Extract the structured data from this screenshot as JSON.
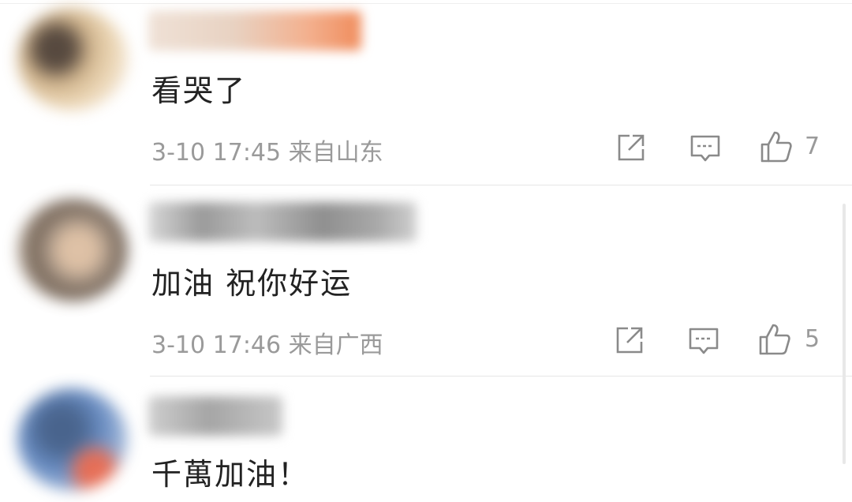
{
  "comments": [
    {
      "text": "看哭了",
      "date": "3-10",
      "time": "17:45",
      "location": "来自山东",
      "likes": "7",
      "avatar_colors": [
        "#c9a87a",
        "#3a2a1e",
        "#e8cfa8"
      ],
      "name_colors": [
        "#e9d8cc",
        "#f0a17a"
      ]
    },
    {
      "text": "加油 祝你好运",
      "date": "3-10",
      "time": "17:46",
      "location": "来自广西",
      "likes": "5",
      "avatar_colors": [
        "#8a7766",
        "#d9b797",
        "#5d4a3a"
      ],
      "name_colors": [
        "#bdbdbd",
        "#8f8f8f"
      ]
    },
    {
      "text": "千萬加油！",
      "avatar_colors": [
        "#4f79b8",
        "#2a4a7a",
        "#e2563a"
      ],
      "name_colors": [
        "#c8c8c8",
        "#a5a5a5"
      ]
    }
  ],
  "icons": {
    "share": "share-icon",
    "comment": "comment-icon",
    "like": "thumbs-up-icon"
  }
}
